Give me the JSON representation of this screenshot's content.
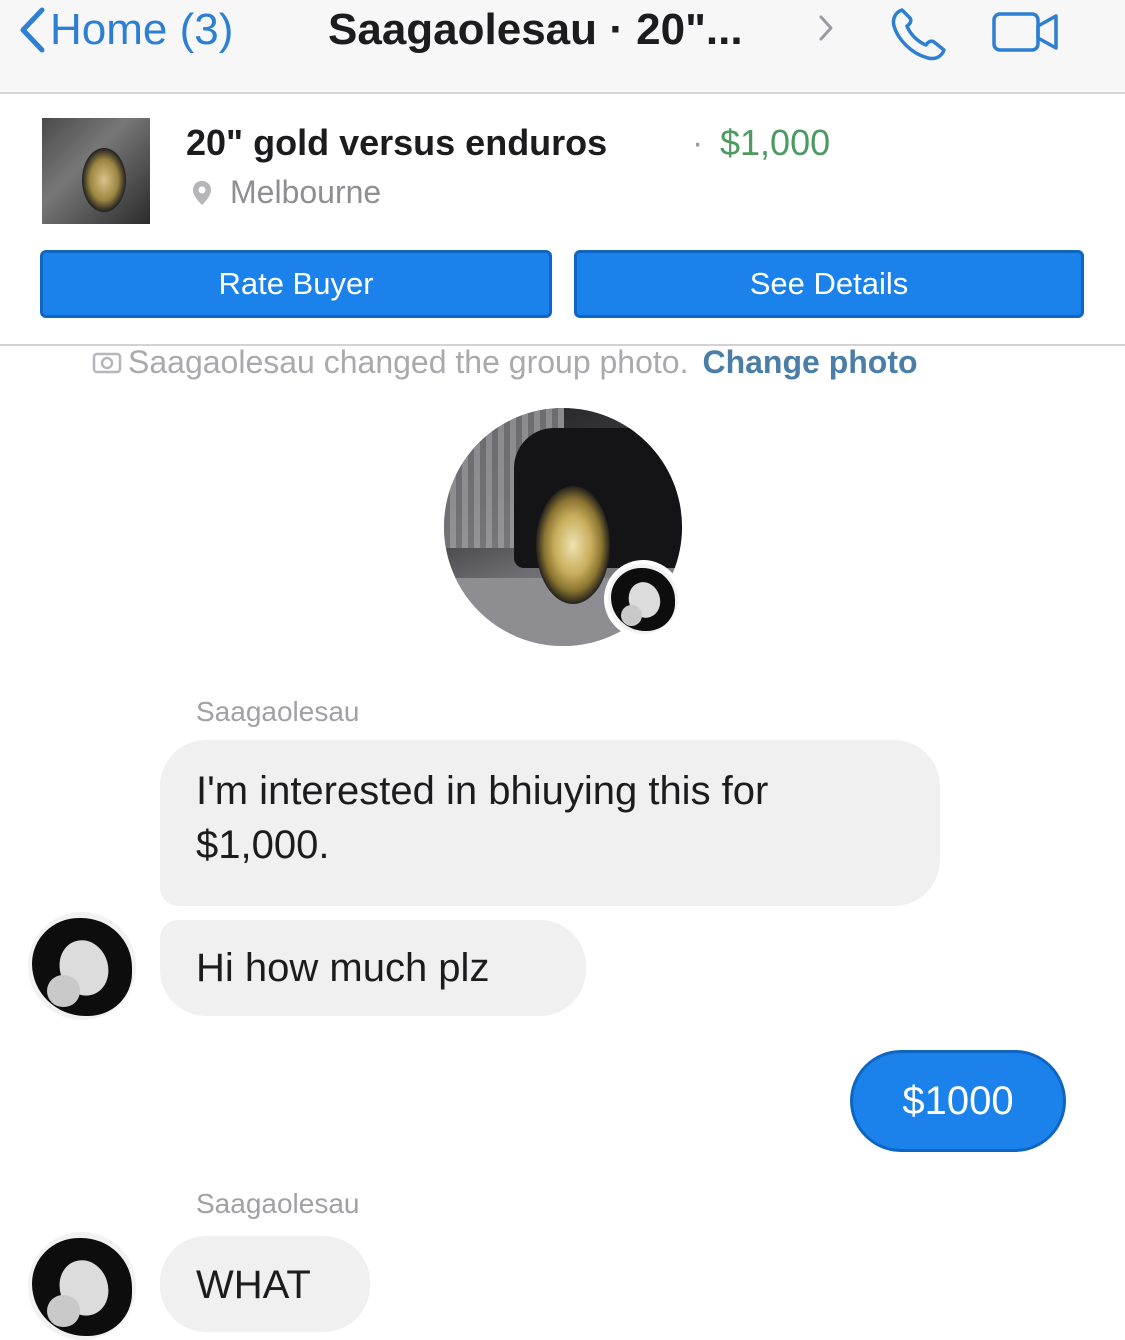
{
  "nav": {
    "back_label": "Home (3)",
    "title": "Saagaolesau · 20\"...",
    "accent_color": "#2d7fd3",
    "icons": [
      "chevron-left-icon",
      "chevron-right-icon",
      "phone-icon",
      "video-camera-icon"
    ]
  },
  "listing": {
    "title": "20\" gold versus enduros",
    "separator": "·",
    "price": "$1,000",
    "price_color": "#4c9a5f",
    "location": "Melbourne",
    "rate_button": "Rate Buyer",
    "details_button": "See Details",
    "button_color": "#1a82ea"
  },
  "notice": {
    "text": "Saagaolesau changed the group photo.",
    "action": "Change photo"
  },
  "messages": [
    {
      "sender": "Saagaolesau",
      "text": "I'm interested in bhiuying this for $1,000.",
      "direction": "incoming"
    },
    {
      "text": "Hi how much plz",
      "direction": "incoming"
    },
    {
      "text": "$1000",
      "direction": "outgoing"
    },
    {
      "sender": "Saagaolesau",
      "text": "WHAT",
      "direction": "incoming"
    }
  ]
}
